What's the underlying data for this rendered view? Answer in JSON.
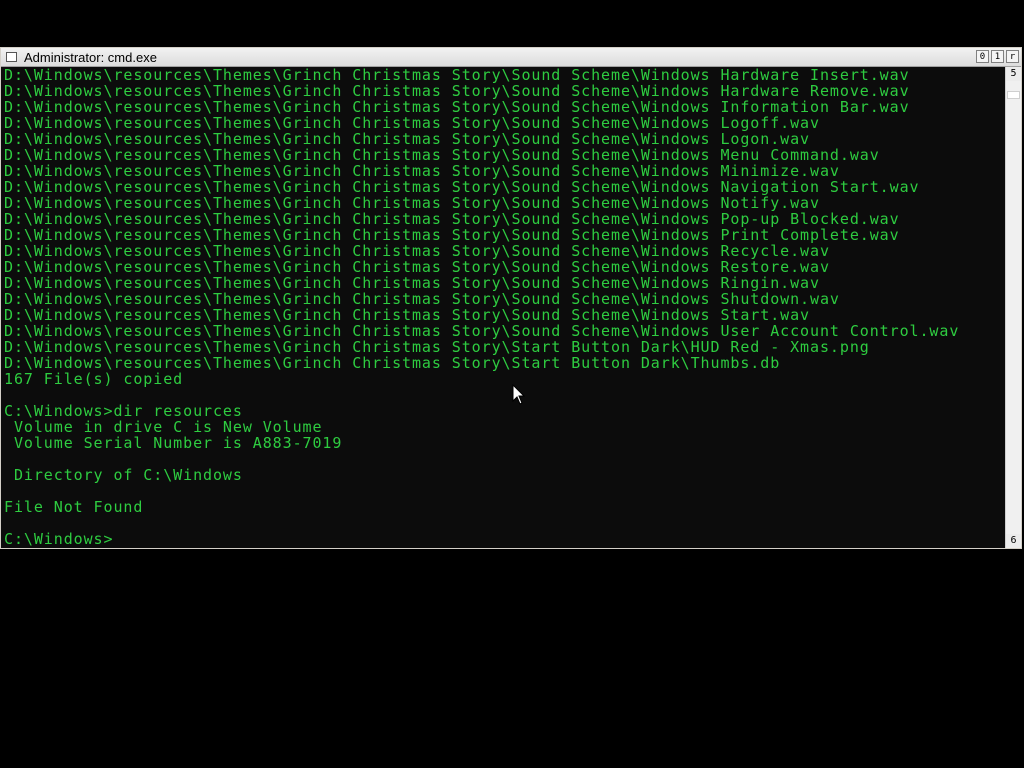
{
  "window": {
    "title": "Administrator: cmd.exe",
    "buttons": [
      "0",
      "1",
      "r"
    ]
  },
  "scrollbar": {
    "up_glyph": "5",
    "down_glyph": "6"
  },
  "console": {
    "lines": [
      {
        "text": "D:\\Windows\\resources\\Themes\\Grinch Christmas Story\\Sound Scheme\\Windows Hardware Insert.wav",
        "color": "#2ecc40"
      },
      {
        "text": "D:\\Windows\\resources\\Themes\\Grinch Christmas Story\\Sound Scheme\\Windows Hardware Remove.wav",
        "color": "#2ecc40"
      },
      {
        "text": "D:\\Windows\\resources\\Themes\\Grinch Christmas Story\\Sound Scheme\\Windows Information Bar.wav",
        "color": "#2ecc40"
      },
      {
        "text": "D:\\Windows\\resources\\Themes\\Grinch Christmas Story\\Sound Scheme\\Windows Logoff.wav",
        "color": "#2ecc40"
      },
      {
        "text": "D:\\Windows\\resources\\Themes\\Grinch Christmas Story\\Sound Scheme\\Windows Logon.wav",
        "color": "#2ecc40"
      },
      {
        "text": "D:\\Windows\\resources\\Themes\\Grinch Christmas Story\\Sound Scheme\\Windows Menu Command.wav",
        "color": "#2ecc40"
      },
      {
        "text": "D:\\Windows\\resources\\Themes\\Grinch Christmas Story\\Sound Scheme\\Windows Minimize.wav",
        "color": "#2ecc40"
      },
      {
        "text": "D:\\Windows\\resources\\Themes\\Grinch Christmas Story\\Sound Scheme\\Windows Navigation Start.wav",
        "color": "#2ecc40"
      },
      {
        "text": "D:\\Windows\\resources\\Themes\\Grinch Christmas Story\\Sound Scheme\\Windows Notify.wav",
        "color": "#2ecc40"
      },
      {
        "text": "D:\\Windows\\resources\\Themes\\Grinch Christmas Story\\Sound Scheme\\Windows Pop-up Blocked.wav",
        "color": "#2ecc40"
      },
      {
        "text": "D:\\Windows\\resources\\Themes\\Grinch Christmas Story\\Sound Scheme\\Windows Print Complete.wav",
        "color": "#2ecc40"
      },
      {
        "text": "D:\\Windows\\resources\\Themes\\Grinch Christmas Story\\Sound Scheme\\Windows Recycle.wav",
        "color": "#2ecc40"
      },
      {
        "text": "D:\\Windows\\resources\\Themes\\Grinch Christmas Story\\Sound Scheme\\Windows Restore.wav",
        "color": "#2ecc40"
      },
      {
        "text": "D:\\Windows\\resources\\Themes\\Grinch Christmas Story\\Sound Scheme\\Windows Ringin.wav",
        "color": "#2ecc40"
      },
      {
        "text": "D:\\Windows\\resources\\Themes\\Grinch Christmas Story\\Sound Scheme\\Windows Shutdown.wav",
        "color": "#2ecc40"
      },
      {
        "text": "D:\\Windows\\resources\\Themes\\Grinch Christmas Story\\Sound Scheme\\Windows Start.wav",
        "color": "#2ecc40"
      },
      {
        "text": "D:\\Windows\\resources\\Themes\\Grinch Christmas Story\\Sound Scheme\\Windows User Account Control.wav",
        "color": "#2ecc40"
      },
      {
        "text": "D:\\Windows\\resources\\Themes\\Grinch Christmas Story\\Start Button Dark\\HUD Red - Xmas.png",
        "color": "#2ecc40"
      },
      {
        "text": "D:\\Windows\\resources\\Themes\\Grinch Christmas Story\\Start Button Dark\\Thumbs.db",
        "color": "#2ecc40"
      },
      {
        "text": "167 File(s) copied",
        "color": "#2ecc40"
      },
      {
        "text": "",
        "color": "#2ecc40"
      },
      {
        "text": "C:\\Windows>dir resources",
        "color": "#2ecc40"
      },
      {
        "text": " Volume in drive C is New Volume",
        "color": "#2ecc40"
      },
      {
        "text": " Volume Serial Number is A883-7019",
        "color": "#2ecc40"
      },
      {
        "text": "",
        "color": "#2ecc40"
      },
      {
        "text": " Directory of C:\\Windows",
        "color": "#2ecc40"
      },
      {
        "text": "",
        "color": "#2ecc40"
      },
      {
        "text": "File Not Found",
        "color": "#2ecc40"
      },
      {
        "text": "",
        "color": "#2ecc40"
      },
      {
        "text": "C:\\Windows>",
        "color": "#2ecc40"
      }
    ]
  },
  "colors": {
    "console_text": "#2ecc40",
    "console_bg": "#0c0c0c",
    "desktop_bg": "#000000"
  },
  "icons": {
    "system_menu": "cmd-icon",
    "pointer": "mouse-pointer-icon"
  }
}
